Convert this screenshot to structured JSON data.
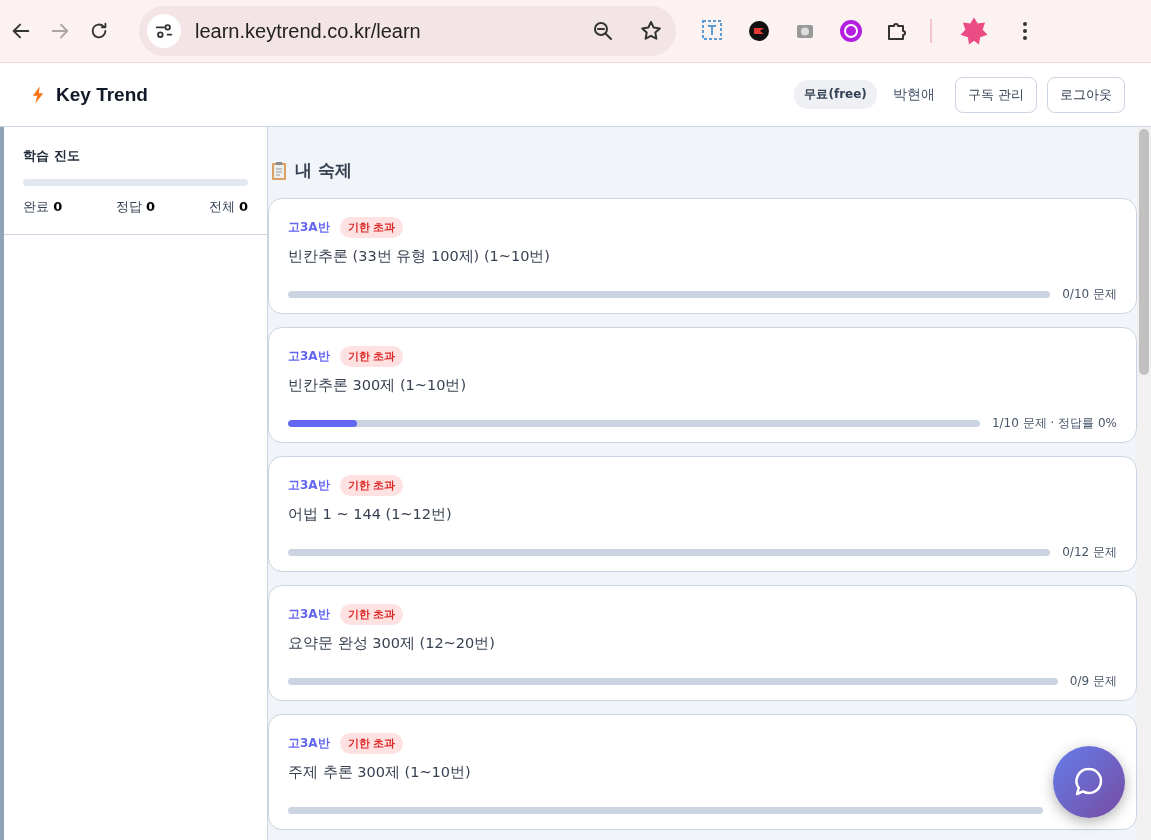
{
  "browser": {
    "url": "learn.keytrend.co.kr/learn",
    "forward_disabled": true
  },
  "header": {
    "brand": "Key Trend",
    "plan": "무료(free)",
    "user": "박현애",
    "buttons": [
      "구독 관리",
      "로그아웃"
    ]
  },
  "sidebar": {
    "title": "학습 진도",
    "level": 0,
    "stats": [
      {
        "label": "완료",
        "value": "0"
      },
      {
        "label": "정답",
        "value": "0"
      },
      {
        "label": "전체",
        "value": "0"
      }
    ]
  },
  "main": {
    "title": "내 숙제",
    "cards": [
      {
        "class": "고3A반",
        "badge": "기한 초과",
        "title": "빈칸추론 (33번 유형 100제) (1~10번)",
        "level": 0,
        "progress": "0/10 문제"
      },
      {
        "class": "고3A반",
        "badge": "기한 초과",
        "title": "빈칸추론 300제 (1~10번)",
        "level": 0.1,
        "progress": "1/10 문제 · 정답률 0%"
      },
      {
        "class": "고3A반",
        "badge": "기한 초과",
        "title": "어법 1 ~ 144 (1~12번)",
        "level": 0,
        "progress": "0/12 문제"
      },
      {
        "class": "고3A반",
        "badge": "기한 초과",
        "title": "요약문 완성 300제 (12~20번)",
        "level": 0,
        "progress": "0/9 문제"
      },
      {
        "class": "고3A반",
        "badge": "기한 초과",
        "title": "주제 추론 300제 (1~10번)",
        "level": 0
      }
    ]
  }
}
